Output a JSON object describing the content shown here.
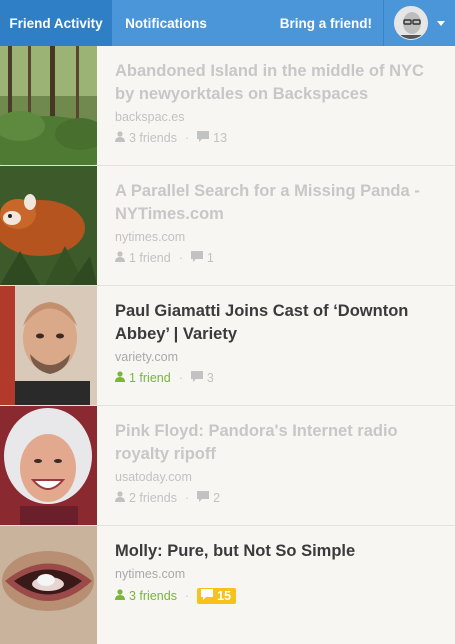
{
  "header": {
    "tab_friend_activity": "Friend Activity",
    "tab_notifications": "Notifications",
    "bring_friend": "Bring a friend!"
  },
  "items": [
    {
      "title": "Abandoned Island in the middle of NYC by newyorktales on Backspaces",
      "domain": "backspac.es",
      "friends": "3 friends",
      "comments": "13",
      "thumb": "forest"
    },
    {
      "title": "A Parallel Search for a Missing Panda - NYTimes.com",
      "domain": "nytimes.com",
      "friends": "1 friend",
      "comments": "1",
      "thumb": "red-panda"
    },
    {
      "title": "Paul Giamatti Joins Cast of ‘Downton Abbey’ | Variety",
      "domain": "variety.com",
      "friends": "1 friend",
      "comments": "3",
      "thumb": "man-portrait"
    },
    {
      "title": "Pink Floyd: Pandora's Internet radio royalty ripoff",
      "domain": "usatoday.com",
      "friends": "2 friends",
      "comments": "2",
      "thumb": "woman-portrait"
    },
    {
      "title": "Molly: Pure, but Not So Simple",
      "domain": "nytimes.com",
      "friends": "3 friends",
      "comments": "15",
      "thumb": "mouth-pill"
    }
  ],
  "colors": {
    "header": "#4a96d8",
    "active_tab": "#2f7fc7",
    "green": "#7ab53c",
    "badge": "#f8c21c"
  }
}
